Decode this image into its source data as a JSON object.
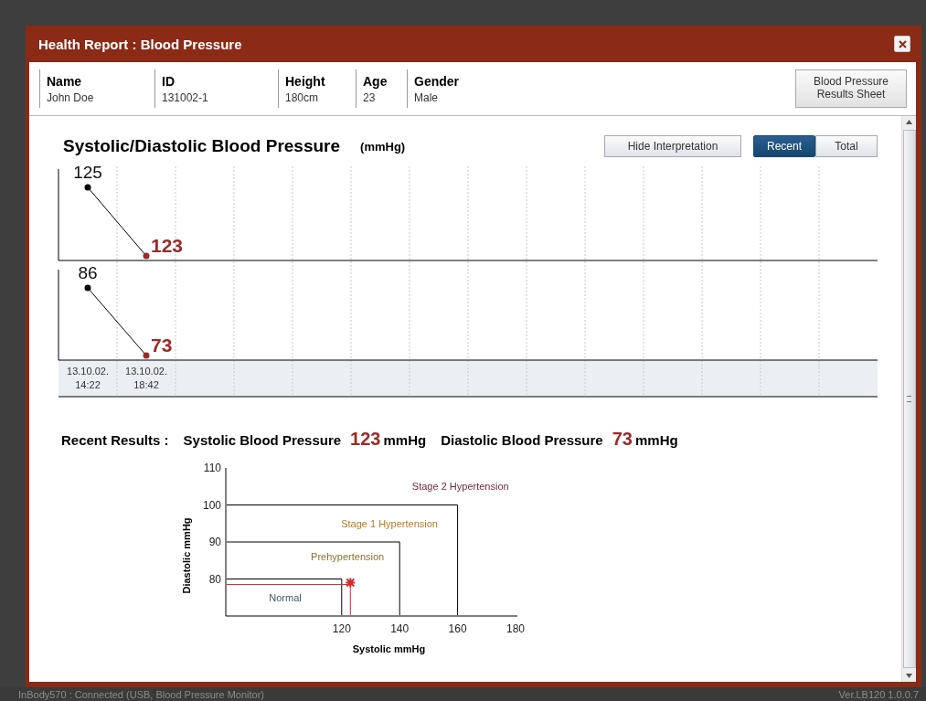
{
  "window": {
    "title": "Health Report : Blood Pressure"
  },
  "profile": [
    {
      "label": "Name",
      "value": "John Doe"
    },
    {
      "label": "ID",
      "value": "131002-1"
    },
    {
      "label": "Height",
      "value": "180cm"
    },
    {
      "label": "Age",
      "value": "23"
    },
    {
      "label": "Gender",
      "value": "Male"
    }
  ],
  "results_sheet_button": "Blood Pressure Results Sheet",
  "trend": {
    "title": "Systolic/Diastolic Blood Pressure",
    "unit": "(mmHg)",
    "interpretation_button": "Hide Interpretation",
    "range_tabs": [
      {
        "label": "Recent",
        "selected": true
      },
      {
        "label": "Total",
        "selected": false
      }
    ],
    "readings": [
      {
        "date": "13.10.02.",
        "time": "14:22",
        "systolic": "125",
        "diastolic": "86",
        "latest": false
      },
      {
        "date": "13.10.02.",
        "time": "18:42",
        "systolic": "123",
        "diastolic": "73",
        "latest": true
      }
    ]
  },
  "recent_results": {
    "label": "Recent Results :",
    "items": [
      {
        "name": "Systolic Blood Pressure",
        "value": "123",
        "unit": "mmHg"
      },
      {
        "name": "Diastolic Blood Pressure",
        "value": "73",
        "unit": "mmHg"
      }
    ]
  },
  "classification": {
    "zones": [
      {
        "label": "Normal",
        "color": "#3d5670"
      },
      {
        "label": "Prehypertension",
        "color": "#8a7030"
      },
      {
        "label": "Stage 1 Hypertension",
        "color": "#b57a20"
      },
      {
        "label": "Stage 2 Hypertension",
        "color": "#6e2a3c"
      }
    ],
    "chart_data": {
      "type": "scatter",
      "xlabel": "Systolic mmHg",
      "ylabel": "Diastolic mmHg",
      "xlim": [
        80,
        180
      ],
      "ylim": [
        70,
        110
      ],
      "xticks": [
        120,
        140,
        160,
        180
      ],
      "yticks": [
        80,
        90,
        100,
        110
      ],
      "x": [
        123
      ],
      "series": [
        {
          "color": "#d42a2a",
          "values": [
            79
          ]
        }
      ]
    }
  },
  "status_bar": {
    "left": "InBody570 : Connected (USB, Blood Pressure Monitor)",
    "right": "Ver.LB120 1.0.0.7"
  }
}
